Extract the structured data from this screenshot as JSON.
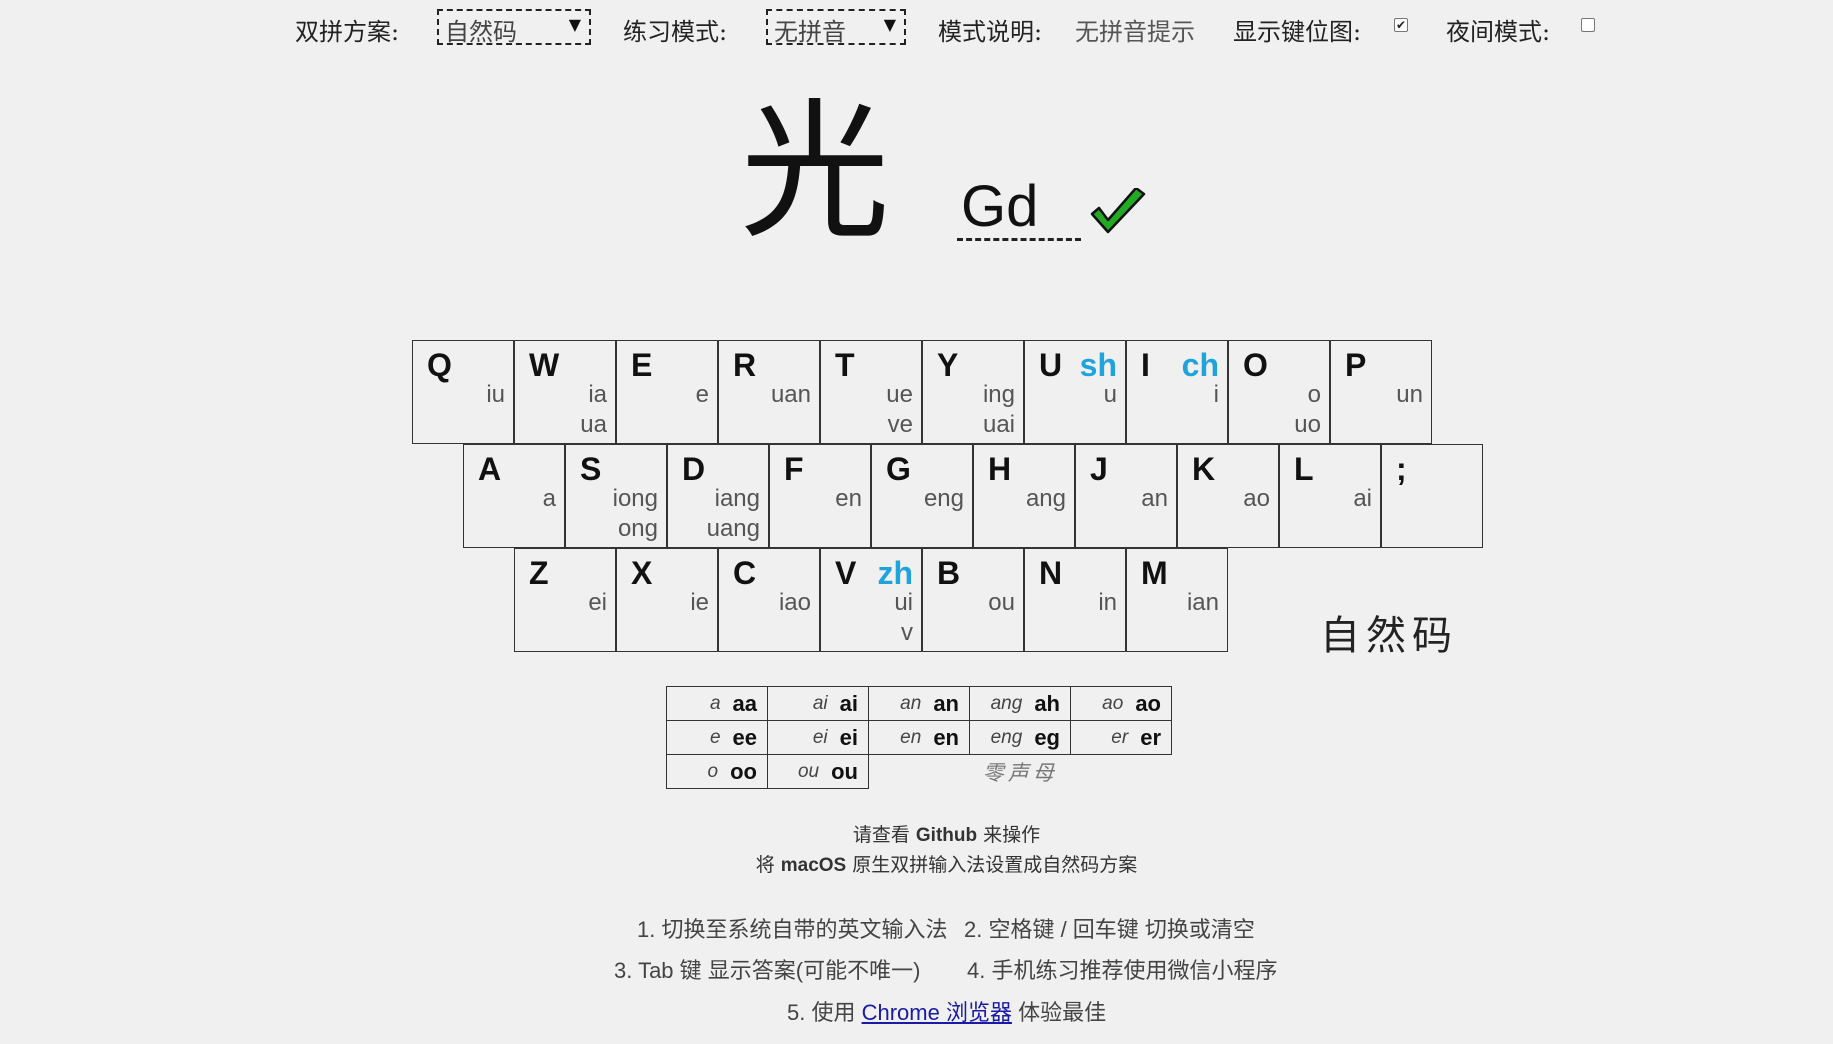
{
  "settings": {
    "scheme_label": "双拼方案:",
    "scheme_value": "自然码",
    "mode_label": "练习模式:",
    "mode_value": "无拼音",
    "desc_label": "模式说明:",
    "desc_value": "无拼音提示",
    "keymap_label": "显示键位图:",
    "keymap_checked": true,
    "night_label": "夜间模式:",
    "night_checked": false,
    "caret": "▼"
  },
  "practice": {
    "character": "光",
    "answer": "Gd",
    "correct": true,
    "check_color": "#22aa22"
  },
  "keyboard": {
    "initial_color": "#1ea3da",
    "rows": [
      [
        {
          "key": "Q",
          "initial": "",
          "finals": [
            "iu"
          ]
        },
        {
          "key": "W",
          "initial": "",
          "finals": [
            "ia",
            "ua"
          ]
        },
        {
          "key": "E",
          "initial": "",
          "finals": [
            "e"
          ]
        },
        {
          "key": "R",
          "initial": "",
          "finals": [
            "uan"
          ]
        },
        {
          "key": "T",
          "initial": "",
          "finals": [
            "ue",
            "ve"
          ]
        },
        {
          "key": "Y",
          "initial": "",
          "finals": [
            "ing",
            "uai"
          ]
        },
        {
          "key": "U",
          "initial": "sh",
          "finals": [
            "u"
          ]
        },
        {
          "key": "I",
          "initial": "ch",
          "finals": [
            "i"
          ]
        },
        {
          "key": "O",
          "initial": "",
          "finals": [
            "o",
            "uo"
          ]
        },
        {
          "key": "P",
          "initial": "",
          "finals": [
            "un"
          ]
        }
      ],
      [
        {
          "key": "A",
          "initial": "",
          "finals": [
            "a"
          ]
        },
        {
          "key": "S",
          "initial": "",
          "finals": [
            "iong",
            "ong"
          ]
        },
        {
          "key": "D",
          "initial": "",
          "finals": [
            "iang",
            "uang"
          ]
        },
        {
          "key": "F",
          "initial": "",
          "finals": [
            "en"
          ]
        },
        {
          "key": "G",
          "initial": "",
          "finals": [
            "eng"
          ]
        },
        {
          "key": "H",
          "initial": "",
          "finals": [
            "ang"
          ]
        },
        {
          "key": "J",
          "initial": "",
          "finals": [
            "an"
          ]
        },
        {
          "key": "K",
          "initial": "",
          "finals": [
            "ao"
          ]
        },
        {
          "key": "L",
          "initial": "",
          "finals": [
            "ai"
          ]
        },
        {
          "key": ";",
          "initial": "",
          "finals": []
        }
      ],
      [
        {
          "key": "Z",
          "initial": "",
          "finals": [
            "ei"
          ]
        },
        {
          "key": "X",
          "initial": "",
          "finals": [
            "ie"
          ]
        },
        {
          "key": "C",
          "initial": "",
          "finals": [
            "iao"
          ]
        },
        {
          "key": "V",
          "initial": "zh",
          "finals": [
            "ui",
            "v"
          ]
        },
        {
          "key": "B",
          "initial": "",
          "finals": [
            "ou"
          ]
        },
        {
          "key": "N",
          "initial": "",
          "finals": [
            "in"
          ]
        },
        {
          "key": "M",
          "initial": "",
          "finals": [
            "ian"
          ]
        }
      ]
    ],
    "scheme_name": "自然码"
  },
  "zero_initial": {
    "rows": [
      [
        [
          "a",
          "aa"
        ],
        [
          "ai",
          "ai"
        ],
        [
          "an",
          "an"
        ],
        [
          "ang",
          "ah"
        ],
        [
          "ao",
          "ao"
        ]
      ],
      [
        [
          "e",
          "ee"
        ],
        [
          "ei",
          "ei"
        ],
        [
          "en",
          "en"
        ],
        [
          "eng",
          "eg"
        ],
        [
          "er",
          "er"
        ]
      ],
      [
        [
          "o",
          "oo"
        ],
        [
          "ou",
          "ou"
        ]
      ]
    ],
    "label": "零声母"
  },
  "footer": {
    "line1_pre": "请查看",
    "line1_bold": "Github",
    "line1_post": "来操作",
    "line2_pre": "将",
    "line2_bold": "macOS",
    "line2_post": "原生双拼输入法设置成自然码方案",
    "tip1": "1. 切换至系统自带的英文输入法",
    "tip2": "2. 空格键 / 回车键 切换或清空",
    "tip3": "3. Tab 键 显示答案(可能不唯一)",
    "tip4": "4. 手机练习推荐使用微信小程序",
    "tip5_pre": "5. 使用",
    "tip5_link": "Chrome 浏览器",
    "tip5_post": "体验最佳"
  }
}
